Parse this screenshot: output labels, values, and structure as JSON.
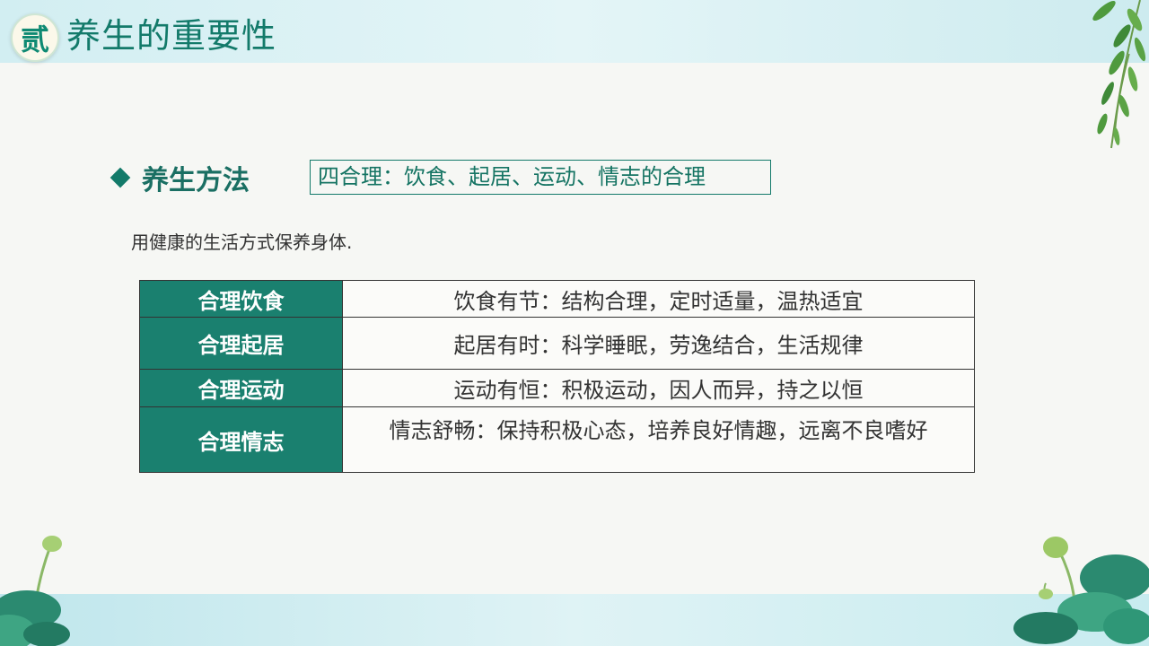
{
  "header": {
    "badge": "贰",
    "title": "养生的重要性"
  },
  "section": {
    "label": "养生方法",
    "summary": "四合理：饮食、起居、运动、情志的合理"
  },
  "intro": "用健康的生活方式保养身体.",
  "table": {
    "rows": [
      {
        "head": "合理饮食",
        "desc": "饮食有节：结构合理，定时适量，温热适宜"
      },
      {
        "head": "合理起居",
        "desc": "起居有时：科学睡眠，劳逸结合，生活规律"
      },
      {
        "head": "合理运动",
        "desc": "运动有恒：积极运动，因人而异，持之以恒"
      },
      {
        "head": "合理情志",
        "desc": "情志舒畅：保持积极心态，培养良好情趣，远离不良嗜好"
      }
    ]
  },
  "colors": {
    "accent": "#1a806f",
    "title": "#137a6a",
    "panel": "#f6f7f4",
    "background": "#d7f0f3"
  },
  "icons": [
    "diamond-icon",
    "willow-branch-icon",
    "lotus-leaf-icon",
    "lotus-bud-icon"
  ]
}
